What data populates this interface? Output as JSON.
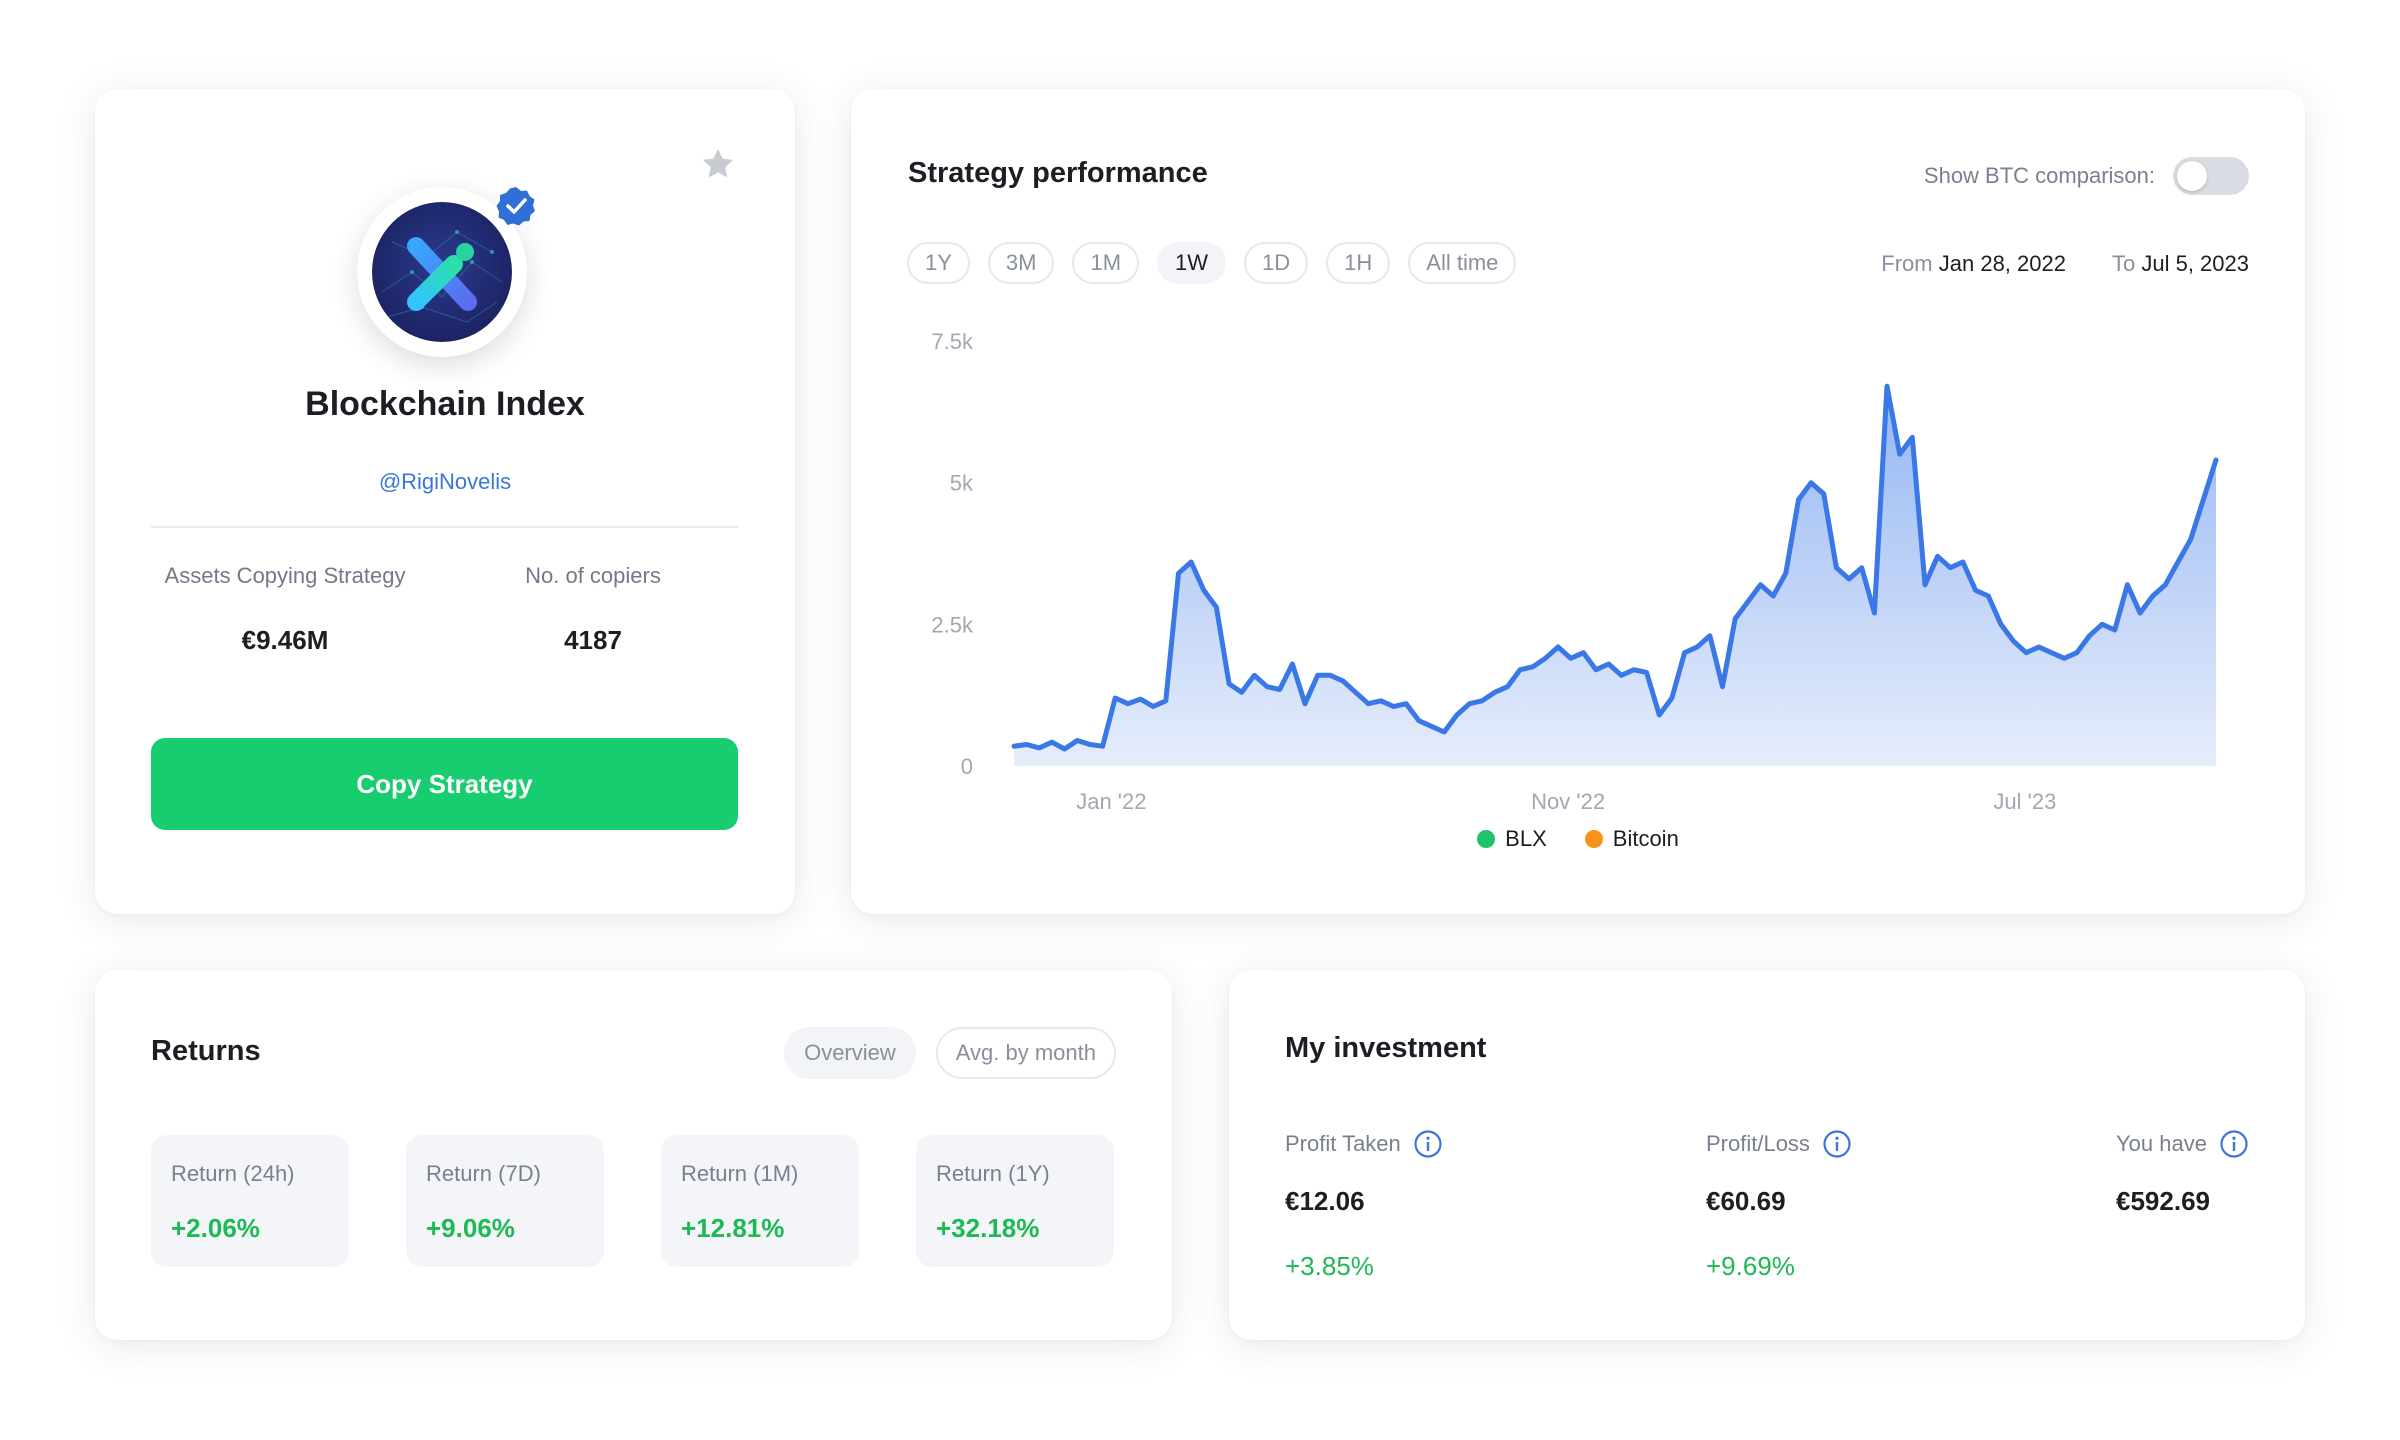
{
  "profile": {
    "title": "Blockchain Index",
    "handle": "@RigiNovelis",
    "stats": [
      {
        "label": "Assets Copying Strategy",
        "value": "€9.46M"
      },
      {
        "label": "No. of copiers",
        "value": "4187"
      }
    ],
    "copy_button": "Copy Strategy"
  },
  "performance": {
    "title": "Strategy performance",
    "btc_toggle_label": "Show BTC comparison:",
    "btc_toggle_on": false,
    "ranges": [
      "1Y",
      "3M",
      "1M",
      "1W",
      "1D",
      "1H",
      "All time"
    ],
    "active_range": "1W",
    "from_label": "From",
    "from_date": "Jan 28, 2022",
    "to_label": "To",
    "to_date": "Jul 5, 2023",
    "legend": [
      {
        "name": "BLX",
        "color": "#1ec46a"
      },
      {
        "name": "Bitcoin",
        "color": "#f7931a"
      }
    ]
  },
  "chart_data": {
    "type": "area",
    "title": "",
    "xlabel": "",
    "ylabel": "",
    "x_ticks": [
      "Jan '22",
      "Nov '22",
      "Jul '23"
    ],
    "y_ticks": [
      "0",
      "2.5k",
      "5k",
      "7.5k"
    ],
    "ylim": [
      0,
      7500
    ],
    "grid": false,
    "legend_position": "bottom",
    "series": [
      {
        "name": "BLX",
        "color": "#3978e6",
        "values": [
          350,
          380,
          320,
          420,
          300,
          450,
          380,
          350,
          1200,
          1100,
          1180,
          1050,
          1150,
          3400,
          3600,
          3100,
          2800,
          1450,
          1300,
          1600,
          1400,
          1350,
          1800,
          1100,
          1600,
          1600,
          1500,
          1300,
          1100,
          1150,
          1050,
          1100,
          800,
          700,
          600,
          900,
          1100,
          1150,
          1300,
          1400,
          1700,
          1750,
          1900,
          2100,
          1900,
          2000,
          1700,
          1800,
          1600,
          1700,
          1650,
          900,
          1200,
          2000,
          2100,
          2300,
          1400,
          2600,
          2900,
          3200,
          3000,
          3400,
          4700,
          5000,
          4800,
          3500,
          3300,
          3500,
          2700,
          6700,
          5500,
          5800,
          3200,
          3700,
          3500,
          3600,
          3100,
          3000,
          2500,
          2200,
          2000,
          2100,
          2000,
          1900,
          2000,
          2300,
          2500,
          2400,
          3200,
          2700,
          3000,
          3200,
          3600,
          4000,
          4700,
          5400
        ]
      }
    ]
  },
  "returns": {
    "title": "Returns",
    "tabs": [
      "Overview",
      "Avg. by month"
    ],
    "items": [
      {
        "label": "Return (24h)",
        "value": "+2.06%"
      },
      {
        "label": "Return (7D)",
        "value": "+9.06%"
      },
      {
        "label": "Return (1M)",
        "value": "+12.81%"
      },
      {
        "label": "Return (1Y)",
        "value": "+32.18%"
      }
    ]
  },
  "investment": {
    "title": "My investment",
    "items": [
      {
        "label": "Profit Taken",
        "value": "€12.06",
        "change": "+3.85%"
      },
      {
        "label": "Profit/Loss",
        "value": "€60.69",
        "change": "+9.69%"
      },
      {
        "label": "You have",
        "value": "€592.69",
        "change": ""
      }
    ]
  }
}
